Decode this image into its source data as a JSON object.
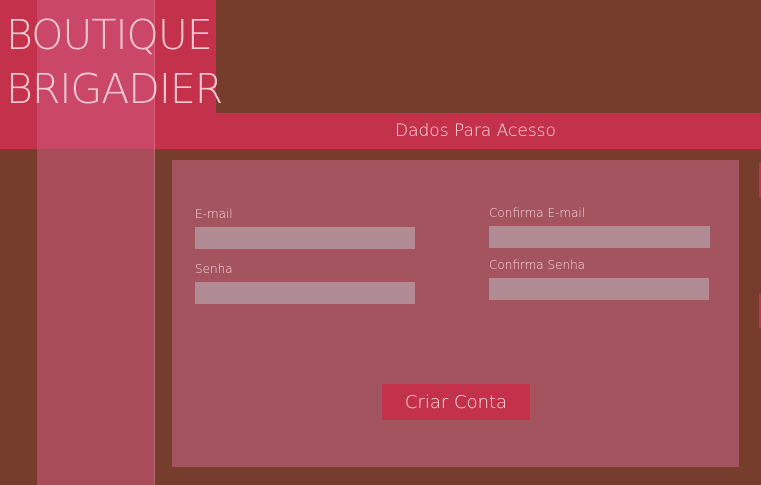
{
  "brand": {
    "line1": "BOUTIQUE",
    "line2": "BRIGADIER"
  },
  "section": {
    "title": "Dados Para Acesso"
  },
  "form": {
    "email_label": "E-mail",
    "email_value": "",
    "confirm_email_label": "Confirma E-mail",
    "confirm_email_value": "",
    "password_label": "Senha",
    "password_value": "",
    "confirm_password_label": "Confirma Senha",
    "confirm_password_value": "",
    "submit_label": "Criar Conta"
  },
  "colors": {
    "background": "#763c2c",
    "accent": "#c4314b",
    "panel": "#a4545f",
    "input": "#b08b93",
    "sidebar": "#d25a82"
  }
}
